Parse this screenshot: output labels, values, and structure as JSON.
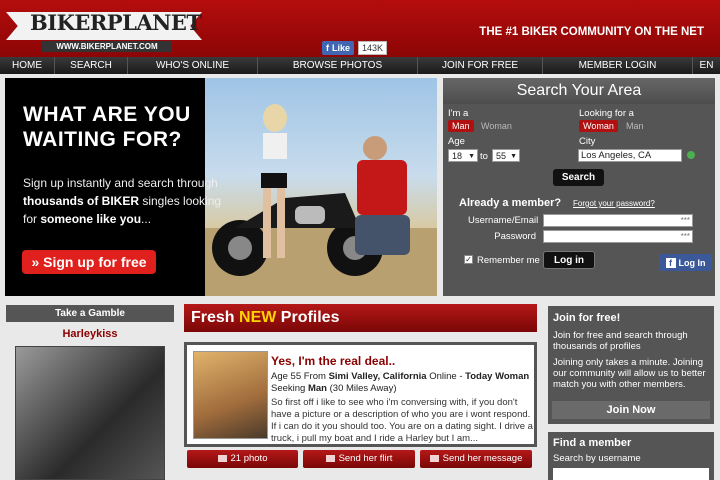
{
  "header": {
    "logo_text": "BIKERPLANET",
    "logo_url": "WWW.BIKERPLANET.COM",
    "tagline": "THE #1 BIKER COMMUNITY ON THE NET",
    "fb_like_label": "Like",
    "fb_like_count": "143K"
  },
  "nav": {
    "items": [
      "HOME",
      "SEARCH",
      "WHO'S ONLINE",
      "BROWSE PHOTOS",
      "JOIN FOR FREE",
      "MEMBER LOGIN",
      "EN"
    ]
  },
  "hero": {
    "headline_line1": "WHAT ARE YOU",
    "headline_line2": "WAITING FOR?",
    "sub_part1": "Sign up instantly and search through ",
    "sub_bold1": "thousands of BIKER",
    "sub_part2": " singles looking for ",
    "sub_bold2": "someone like you",
    "sub_part3": "...",
    "signup_label": "» Sign up for free"
  },
  "search": {
    "title": "Search Your Area",
    "im_a_label": "I'm a",
    "im_a_selected": "Man",
    "im_a_other": "Woman",
    "looking_label": "Looking for a",
    "looking_selected": "Woman",
    "looking_other": "Man",
    "age_label": "Age",
    "age_from": "18",
    "age_to_label": "to",
    "age_to": "55",
    "city_label": "City",
    "city_value": "Los Angeles, CA",
    "search_button": "Search"
  },
  "login": {
    "title": "Already a member?",
    "forgot": "Forgot your password?",
    "username_label": "Username/Email",
    "username_value": "***",
    "password_label": "Password",
    "password_value": "***",
    "remember_label": "Remember me",
    "login_button": "Log in",
    "fb_login": "Log In"
  },
  "gamble": {
    "title": "Take a Gamble",
    "name": "Harleykiss"
  },
  "fresh": {
    "title_part1": "Fresh ",
    "title_new": "NEW",
    "title_part2": " Profiles",
    "profile": {
      "headline": "Yes, I'm the real deal..",
      "meta_age": "Age 55 From ",
      "meta_location": "Simi Valley, California",
      "meta_online": " Online - ",
      "meta_today": "Today",
      "meta_woman": "Woman",
      "meta_seeking": " Seeking ",
      "meta_man": "Man",
      "meta_distance": " (30 Miles Away)",
      "bio": "So first off i like to see who i'm conversing with, if you don't have a picture or a description of who you are i wont respond. If i can do it you should too. You are on a dating sight. I drive a truck, i pull my boat and I ride a Harley but I am..."
    },
    "actions": {
      "photos": "21 photo",
      "flirt": "Send her flirt",
      "message": "Send her message"
    }
  },
  "join": {
    "title": "Join for free!",
    "text1": "Join for free and search through thousands of profiles",
    "text2": "Joining only takes a minute. Joining our community will allow us to better match you with other members.",
    "button": "Join Now"
  },
  "find": {
    "title": "Find a member",
    "label": "Search by username"
  }
}
